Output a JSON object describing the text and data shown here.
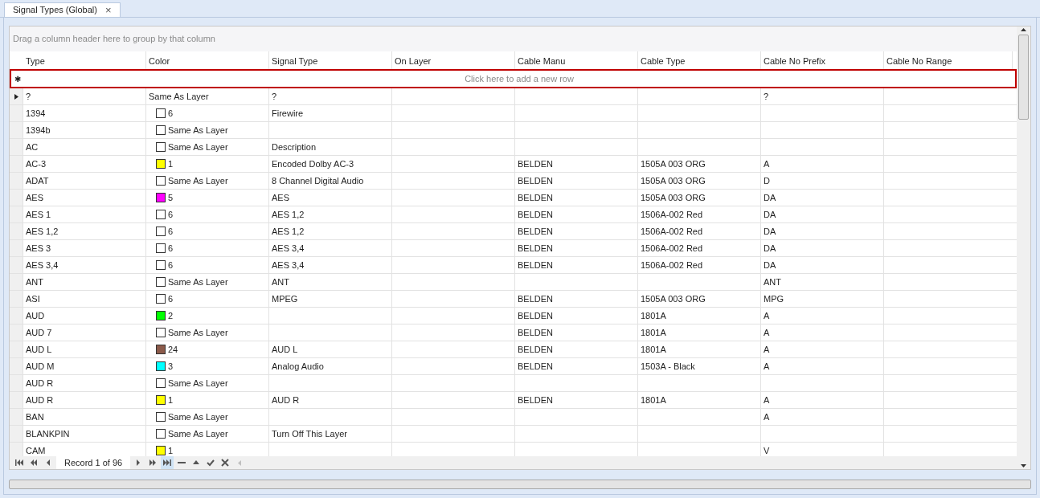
{
  "tabs": [
    {
      "label": "Signal Types (Global)",
      "selected": true,
      "close": "×"
    }
  ],
  "group_panel": {
    "hint": "Drag a column header here to group by that column"
  },
  "table": {
    "columns": [
      "Type",
      "Color",
      "Signal Type",
      "On Layer",
      "Cable Manu",
      "Cable Type",
      "Cable No Prefix",
      "Cable No Range"
    ],
    "new_row": {
      "marker": "✱",
      "hint": "Click here to add a new row",
      "highlighted": true
    },
    "rows": [
      {
        "current": true,
        "type": "?",
        "color": {
          "text": "Same As Layer"
        },
        "signal": "?",
        "manu": "",
        "cable": "",
        "prefix": "?"
      },
      {
        "current": false,
        "type": "1394",
        "color": {
          "text": "6",
          "color": "#ffffff"
        },
        "signal": "Firewire",
        "manu": "",
        "cable": "",
        "prefix": ""
      },
      {
        "current": false,
        "type": "1394b",
        "color": {
          "text": "Same As Layer",
          "color": "#ffffff"
        },
        "signal": "",
        "manu": "",
        "cable": "",
        "prefix": ""
      },
      {
        "current": false,
        "type": "AC",
        "color": {
          "text": "Same As Layer",
          "color": "#ffffff"
        },
        "signal": "Description",
        "manu": "",
        "cable": "",
        "prefix": ""
      },
      {
        "current": false,
        "type": "AC-3",
        "color": {
          "text": "1",
          "color": "#ffff00"
        },
        "signal": "Encoded Dolby AC-3",
        "manu": "BELDEN",
        "cable": "1505A 003 ORG",
        "prefix": "A"
      },
      {
        "current": false,
        "type": "ADAT",
        "color": {
          "text": "Same As Layer",
          "color": "#ffffff"
        },
        "signal": "8 Channel Digital Audio",
        "manu": "BELDEN",
        "cable": "1505A 003 ORG",
        "prefix": "D"
      },
      {
        "current": false,
        "type": "AES",
        "color": {
          "text": "5",
          "color": "#ff00ff"
        },
        "signal": "AES",
        "manu": "BELDEN",
        "cable": "1505A 003 ORG",
        "prefix": "DA"
      },
      {
        "current": false,
        "type": "AES 1",
        "color": {
          "text": "6",
          "color": "#ffffff"
        },
        "signal": "AES 1,2",
        "manu": "BELDEN",
        "cable": "1506A-002 Red",
        "prefix": "DA"
      },
      {
        "current": false,
        "type": "AES 1,2",
        "color": {
          "text": "6",
          "color": "#ffffff"
        },
        "signal": "AES 1,2",
        "manu": "BELDEN",
        "cable": "1506A-002 Red",
        "prefix": "DA"
      },
      {
        "current": false,
        "type": "AES 3",
        "color": {
          "text": "6",
          "color": "#ffffff"
        },
        "signal": "AES 3,4",
        "manu": "BELDEN",
        "cable": "1506A-002 Red",
        "prefix": "DA"
      },
      {
        "current": false,
        "type": "AES 3,4",
        "color": {
          "text": "6",
          "color": "#ffffff"
        },
        "signal": "AES 3,4",
        "manu": "BELDEN",
        "cable": "1506A-002 Red",
        "prefix": "DA"
      },
      {
        "current": false,
        "type": "ANT",
        "color": {
          "text": "Same As Layer",
          "color": "#ffffff"
        },
        "signal": "ANT",
        "manu": "",
        "cable": "",
        "prefix": "ANT"
      },
      {
        "current": false,
        "type": "ASI",
        "color": {
          "text": "6",
          "color": "#ffffff"
        },
        "signal": "MPEG",
        "manu": "BELDEN",
        "cable": "1505A 003 ORG",
        "prefix": "MPG"
      },
      {
        "current": false,
        "type": "AUD",
        "color": {
          "text": "2",
          "color": "#00ff00"
        },
        "signal": "",
        "manu": "BELDEN",
        "cable": "1801A",
        "prefix": "A"
      },
      {
        "current": false,
        "type": "AUD 7",
        "color": {
          "text": "Same As Layer",
          "color": "#ffffff"
        },
        "signal": "",
        "manu": "BELDEN",
        "cable": "1801A",
        "prefix": "A"
      },
      {
        "current": false,
        "type": "AUD L",
        "color": {
          "text": "24",
          "color": "#8b5a4a"
        },
        "signal": "AUD L",
        "manu": "BELDEN",
        "cable": "1801A",
        "prefix": "A"
      },
      {
        "current": false,
        "type": "AUD M",
        "color": {
          "text": "3",
          "color": "#00ffff"
        },
        "signal": "Analog Audio",
        "manu": "BELDEN",
        "cable": "1503A - Black",
        "prefix": "A"
      },
      {
        "current": false,
        "type": "AUD R",
        "color": {
          "text": "Same As Layer",
          "color": "#ffffff"
        },
        "signal": "",
        "manu": "",
        "cable": "",
        "prefix": ""
      },
      {
        "current": false,
        "type": "AUD R",
        "color": {
          "text": "1",
          "color": "#ffff00"
        },
        "signal": "AUD R",
        "manu": "BELDEN",
        "cable": "1801A",
        "prefix": "A"
      },
      {
        "current": false,
        "type": "BAN",
        "color": {
          "text": "Same As Layer",
          "color": "#ffffff"
        },
        "signal": "",
        "manu": "",
        "cable": "",
        "prefix": "A"
      },
      {
        "current": false,
        "type": "BLANKPIN",
        "color": {
          "text": "Same As Layer",
          "color": "#ffffff"
        },
        "signal": "Turn Off This Layer",
        "manu": "",
        "cable": "",
        "prefix": ""
      },
      {
        "current": false,
        "type": "CAM",
        "color": {
          "text": "1",
          "color": "#ffff00"
        },
        "signal": "",
        "manu": "",
        "cable": "",
        "prefix": "V"
      }
    ]
  },
  "navigator": {
    "record": "Record 1 of 96",
    "buttons": [
      {
        "kind": "first",
        "selected": false
      },
      {
        "kind": "prev_page",
        "selected": false
      },
      {
        "kind": "prev",
        "selected": false
      },
      {
        "kind": "record"
      },
      {
        "kind": "next",
        "selected": false
      },
      {
        "kind": "next_page",
        "selected": false
      },
      {
        "kind": "last",
        "selected": true
      },
      {
        "kind": "delete",
        "selected": false
      },
      {
        "kind": "up",
        "selected": false
      },
      {
        "kind": "apply",
        "selected": false
      },
      {
        "kind": "cancel",
        "selected": false
      }
    ]
  }
}
